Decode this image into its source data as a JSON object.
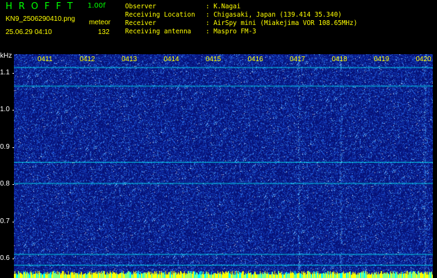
{
  "header": {
    "app_name": "HROFFT",
    "version": "1.00f",
    "filename": "KN9_2506290410.png",
    "mode": "meteor",
    "datetime": "25.06.29 04:10",
    "count": "132"
  },
  "station": {
    "observer_label": "Observer",
    "observer_value": ": K.Nagai",
    "location_label": "Receiving Location",
    "location_value": ": Chigasaki, Japan (139.414 35.340)",
    "receiver_label": "Receiver",
    "receiver_value": ": AirSpy mini (Miakejima VOR 108.65MHz)",
    "antenna_label": "Receiving antenna",
    "antenna_value": ": Maspro FM-3"
  },
  "spectrogram": {
    "unit": "kHz",
    "y_ticks": [
      "1.1",
      "1.0",
      "0.9",
      "0.8",
      "0.7",
      "0.6"
    ],
    "y_range": [
      0.57,
      1.15
    ],
    "x_ticks": [
      "0411",
      "0412",
      "0413",
      "0414",
      "0415",
      "0416",
      "0417",
      "0418",
      "0419",
      "0420"
    ],
    "background_color": "#0a1a8c",
    "speckle_color": "#3a8cff",
    "line_color": "#00ffff",
    "bar_color": "#ffff00",
    "horizontal_lines_khz": [
      1.115,
      1.065,
      0.86,
      0.803,
      0.612,
      0.583
    ],
    "vertical_lines_minute": [
      "0417",
      "0418",
      "0420"
    ]
  }
}
